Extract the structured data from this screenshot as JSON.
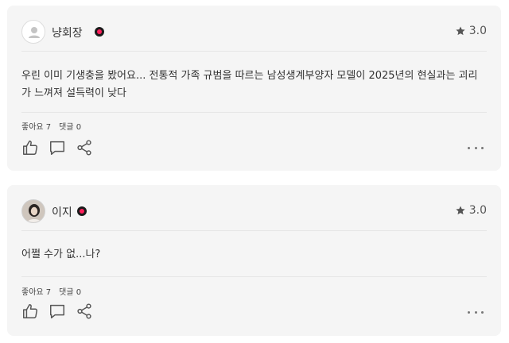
{
  "colors": {
    "card_bg": "#f5f5f5",
    "badge_dot": "#ff1f5b",
    "icon": "#555555"
  },
  "reviews": [
    {
      "username": "냥회장",
      "rating": "3.0",
      "content": "우린 이미 기생충을 봤어요... 전통적 가족 규범을 따르는 남성생계부양자 모델이 2025년의 현실과는 괴리가 느껴져 설득력이 낮다",
      "likes": "좋아요 7",
      "comments": "댓글 0",
      "avatar": "default-user-icon"
    },
    {
      "username": "이지",
      "rating": "3.0",
      "content": "어쩔 수가 없...나?",
      "likes": "좋아요 7",
      "comments": "댓글 0",
      "avatar": "profile-photo"
    }
  ]
}
